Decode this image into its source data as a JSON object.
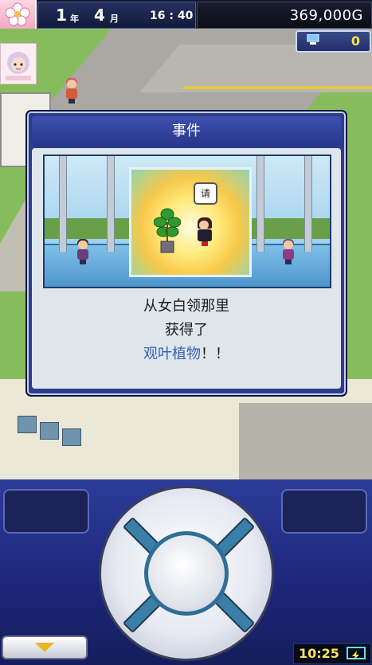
{
  "hud": {
    "year_value": "1",
    "year_unit": "年",
    "month_value": "4",
    "month_unit": "月",
    "time": "16 : 40",
    "money": "369,000G",
    "pc_count": "0"
  },
  "dialog": {
    "title": "事件",
    "speech": "请",
    "message_line1": "从女白领那里",
    "message_line2": "获得了",
    "item_name": "观叶植物",
    "item_suffix": "！！"
  },
  "controller": {
    "clock": "10:25"
  },
  "colors": {
    "dialog_frame": "#2e3d8a",
    "highlight_text": "#3760b8",
    "money_text": "#ffffff",
    "clock_text": "#ffe15a"
  },
  "icons": [
    "sakura-icon",
    "pc-icon",
    "advisor-icon",
    "plant-icon",
    "arrow-down-icon",
    "battery-icon"
  ]
}
